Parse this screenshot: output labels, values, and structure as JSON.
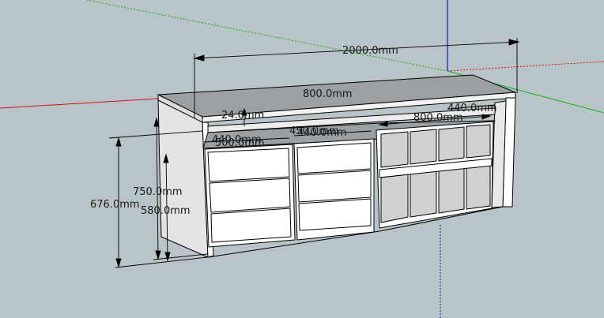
{
  "app": {
    "background_color": "#b8c4c8",
    "edge_color": "#000000",
    "face_color": "#ffffff",
    "shadow_face_color": "#e0e0e0",
    "top_surface_color": "#9aa0a3"
  },
  "axes": {
    "red_color": "#d01010",
    "green_color": "#10b010",
    "blue_color": "#1010d0"
  },
  "dimensions": {
    "overall_width": "2000.0mm",
    "depth_top": "800.0mm",
    "top_thickness": "24.0mm",
    "drawer_width_left_a": "440.0mm",
    "drawer_width_left_b": "500.0mm",
    "drawer_width_mid": "450.0mm",
    "drawer_width_mid_b": "440.0mm",
    "shelf_width": "800.0mm",
    "shelf_depth": "440.0mm",
    "height_750": "750.0mm",
    "height_676": "676.0mm",
    "height_580": "580.0mm"
  }
}
